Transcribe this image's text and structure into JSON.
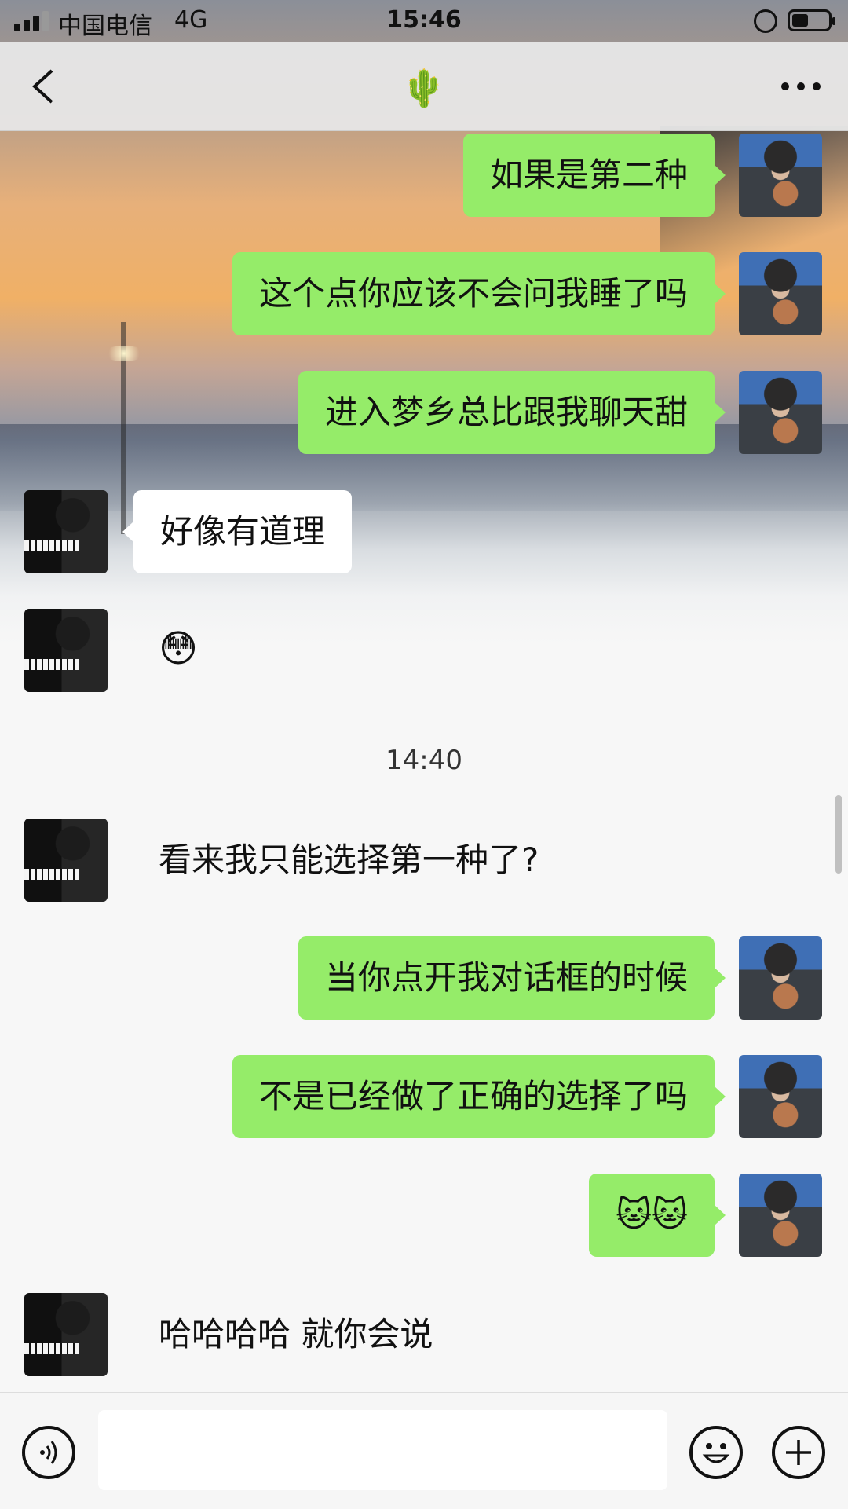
{
  "status_bar": {
    "carrier": "中国电信",
    "network": "4G",
    "time": "15:46",
    "battery_level": 0.45
  },
  "nav": {
    "title_emoji": "🌵",
    "back_icon": "chevron-left-icon",
    "more_icon": "more-horizontal-icon"
  },
  "messages": [
    {
      "sender": "me",
      "text": "如果是第二种"
    },
    {
      "sender": "me",
      "text": "这个点你应该不会问我睡了吗"
    },
    {
      "sender": "me",
      "text": "进入梦乡总比跟我聊天甜"
    },
    {
      "sender": "her",
      "text": "好像有道理"
    },
    {
      "sender": "her",
      "text": "😳"
    },
    {
      "sender": "her",
      "text": "看来我只能选择第一种了?"
    },
    {
      "sender": "me",
      "text": "当你点开我对话框的时候"
    },
    {
      "sender": "me",
      "text": "不是已经做了正确的选择了吗"
    },
    {
      "sender": "me",
      "text": "🐱🐱"
    },
    {
      "sender": "her",
      "text": "哈哈哈哈 就你会说"
    }
  ],
  "timestamp": "14:40",
  "input": {
    "placeholder": "",
    "value": ""
  },
  "colors": {
    "my_bubble": "#95ec69",
    "her_bubble": "#ffffff",
    "chat_background": "#f7f7f7"
  }
}
